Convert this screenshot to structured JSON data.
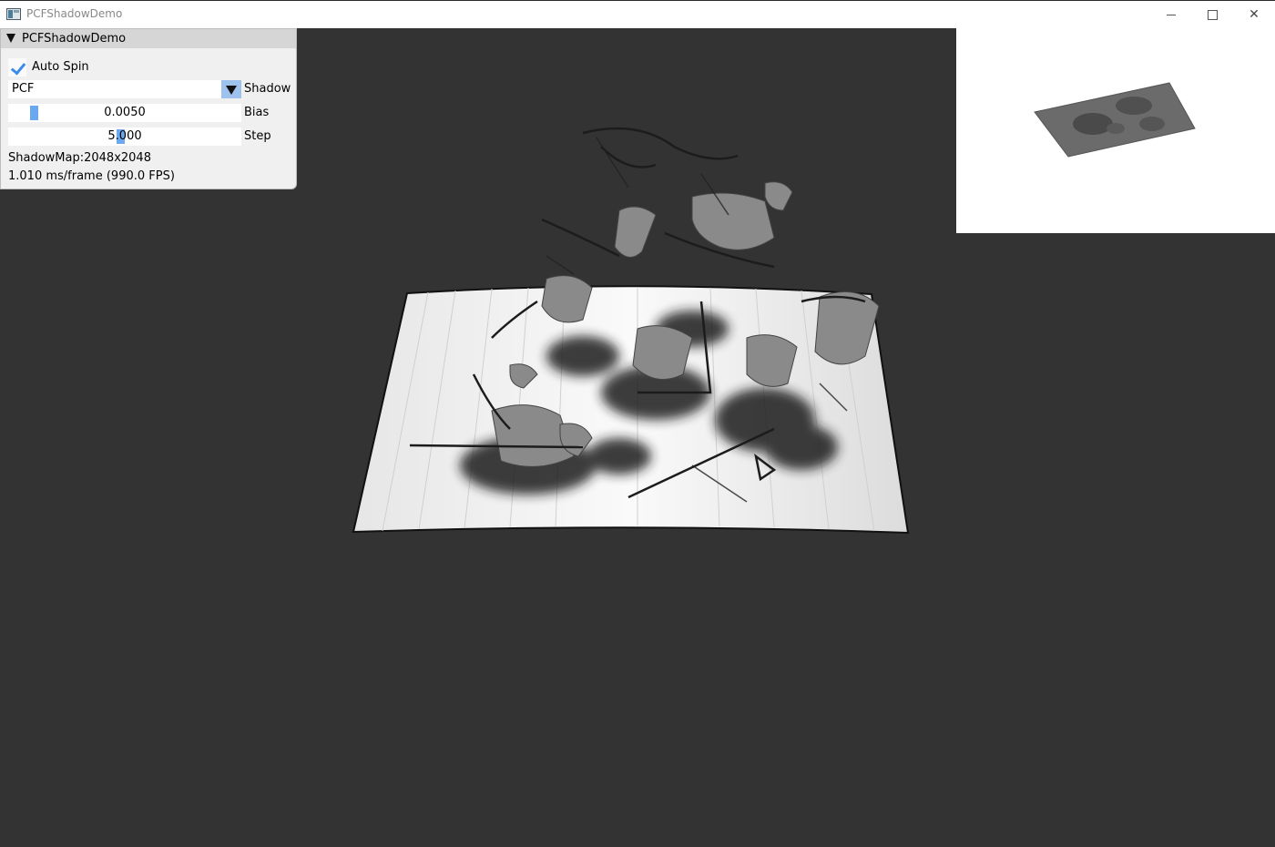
{
  "window": {
    "title": "PCFShadowDemo",
    "controls": [
      "minimize-icon",
      "maximize-icon",
      "close-icon"
    ]
  },
  "panel": {
    "title": "PCFShadowDemo",
    "auto_spin": {
      "label": "Auto Spin",
      "checked": true
    },
    "shadow_combo": {
      "value": "PCF",
      "label": "Shadow"
    },
    "bias_slider": {
      "value": "0.0050",
      "label": "Bias",
      "fraction": 0.1
    },
    "step_slider": {
      "value": "5.000",
      "label": "Step",
      "fraction": 0.5
    },
    "shadowmap_info": "ShadowMap:2048x2048",
    "perf_info": "1.010 ms/frame (990.0 FPS)"
  },
  "colors": {
    "viewport_bg": "#333333",
    "panel_bg": "#f0f0f0",
    "accent": "#6aa8f0",
    "check": "#3b8beb"
  }
}
